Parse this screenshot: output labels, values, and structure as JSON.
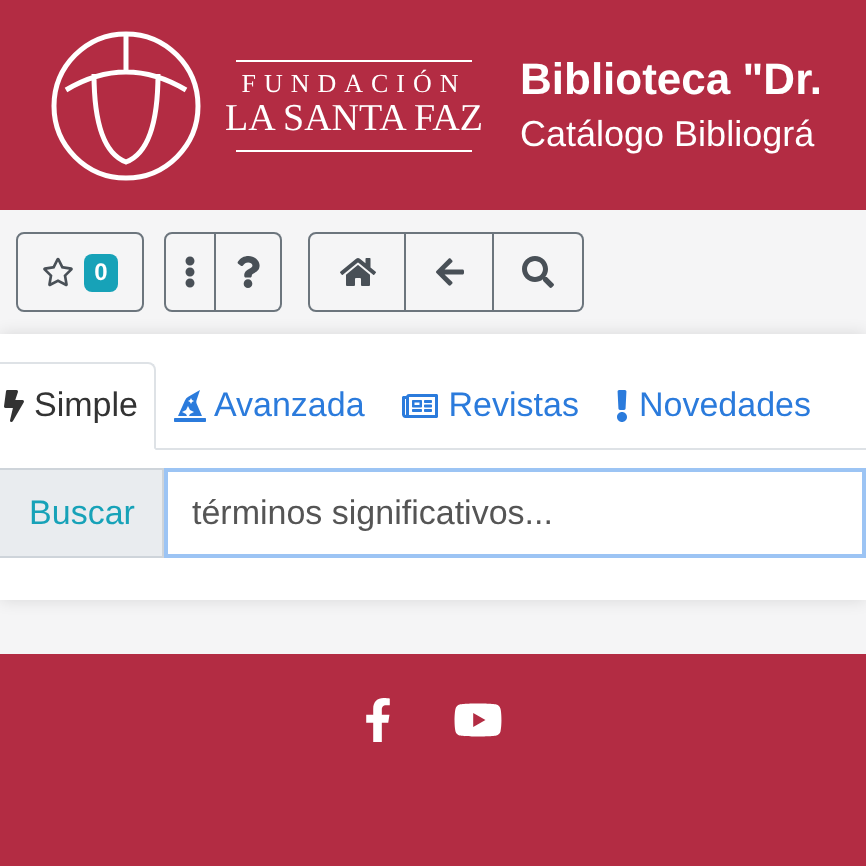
{
  "header": {
    "logo": {
      "line_1": "FUNDACIÓN",
      "line_2": "LA SANTA FAZ"
    },
    "title": "Biblioteca \"Dr.",
    "subtitle": "Catálogo Bibliográ"
  },
  "toolbar": {
    "favorites_count": "0"
  },
  "tabs": [
    {
      "label": "Simple",
      "kind": "quick",
      "selected": true
    },
    {
      "label": "Avanzada",
      "kind": "advanced",
      "selected": false
    },
    {
      "label": "Revistas",
      "kind": "journals",
      "selected": false
    },
    {
      "label": "Novedades",
      "kind": "news",
      "selected": false
    }
  ],
  "search": {
    "button": "Buscar",
    "placeholder": "términos significativos..."
  }
}
